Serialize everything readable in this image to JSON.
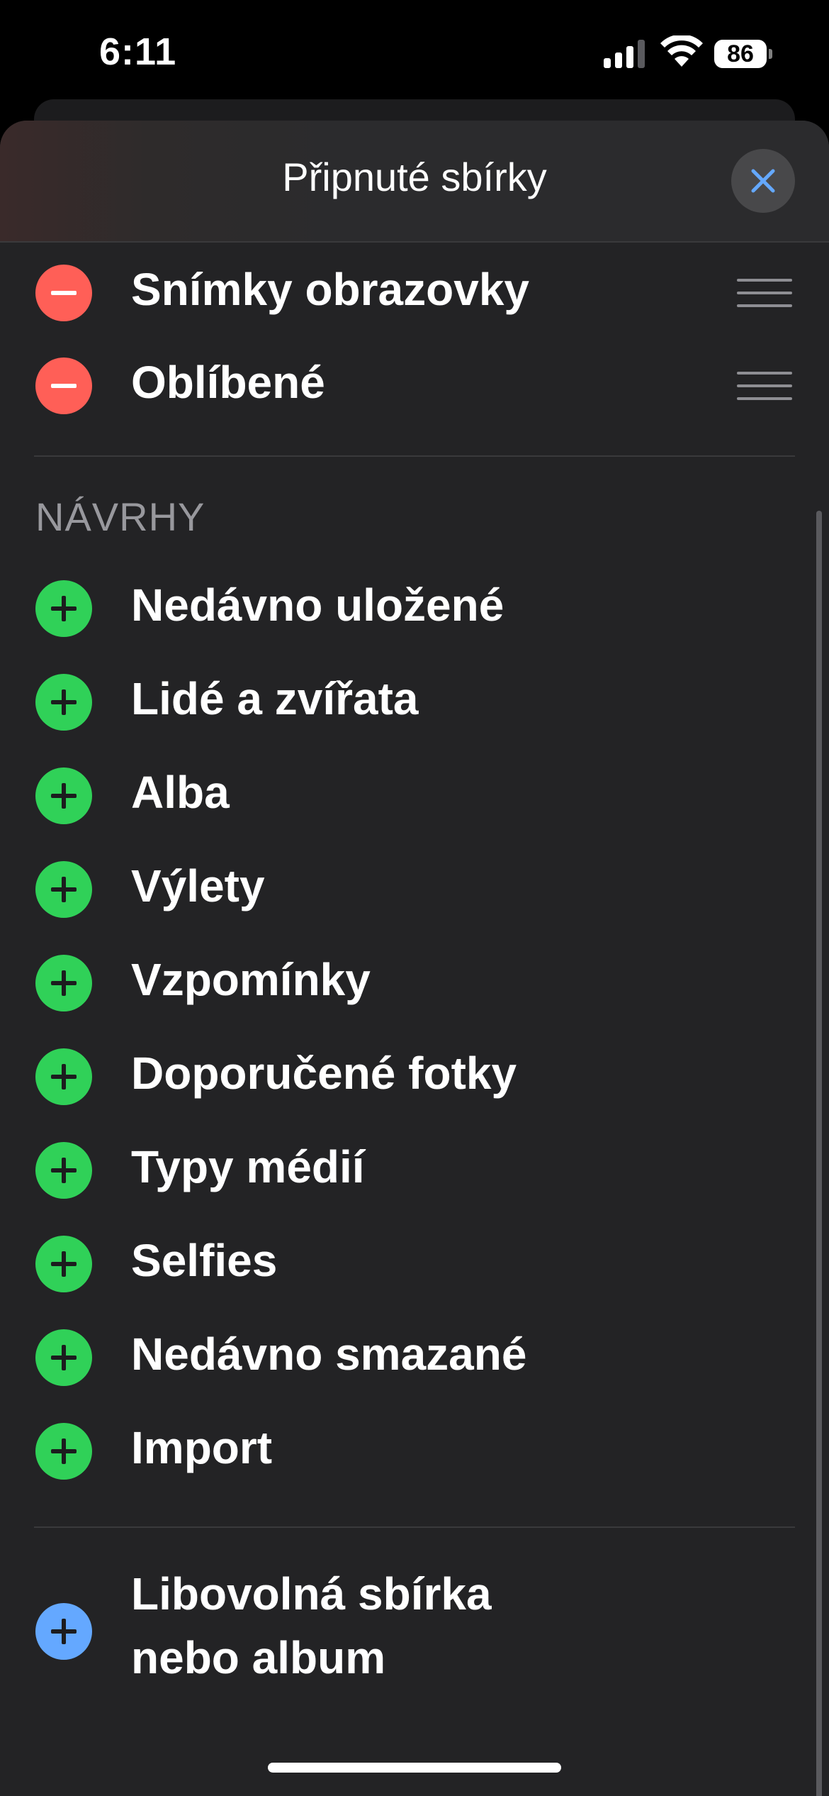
{
  "status_bar": {
    "time": "6:11",
    "battery": "86"
  },
  "sheet": {
    "title": "Připnuté sbírky",
    "close_icon": "close-icon",
    "pinned": [
      {
        "label": "Snímky obrazovky",
        "action": "remove"
      },
      {
        "label": "Oblíbené",
        "action": "remove"
      }
    ],
    "suggestions_header": "NÁVRHY",
    "suggestions": [
      {
        "label": "Nedávno uložené"
      },
      {
        "label": "Lidé a zvířata"
      },
      {
        "label": "Alba"
      },
      {
        "label": "Výlety"
      },
      {
        "label": "Vzpomínky"
      },
      {
        "label": "Doporučené fotky"
      },
      {
        "label": "Typy médií"
      },
      {
        "label": "Selfies"
      },
      {
        "label": "Nedávno smazané"
      },
      {
        "label": "Import"
      }
    ],
    "custom": {
      "line1": "Libovolná sbírka",
      "line2": "nebo album"
    }
  },
  "colors": {
    "remove": "#ff5f57",
    "add": "#30d158",
    "custom_add": "#64a8ff",
    "accent": "#64a8ff"
  }
}
